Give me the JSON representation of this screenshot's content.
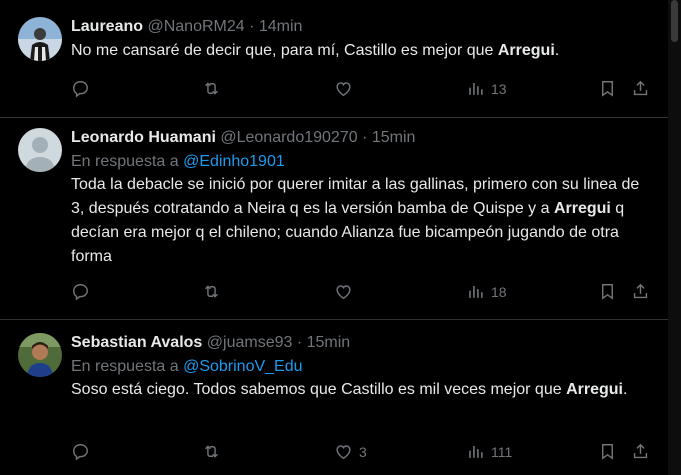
{
  "tweets": [
    {
      "name": "Laureano",
      "handle": "@NanoRM24",
      "sep": "·",
      "time": "14min",
      "reply_prefix": "",
      "reply_to": "",
      "text_before": "No me cansaré de decir que, para mí, Castillo es mejor que ",
      "text_bold": "Arregui",
      "text_after": ".",
      "replies": "",
      "retweets": "",
      "likes": "",
      "views": "13"
    },
    {
      "name": "Leonardo Huamani",
      "handle": "@Leonardo190270",
      "sep": "·",
      "time": "15min",
      "reply_prefix": "En respuesta a ",
      "reply_to": "@Edinho1901",
      "text_before": "Toda la debacle se inició por querer imitar a las gallinas, primero con su linea de 3, después cotratando a Neira q es la versión bamba de Quispe y a ",
      "text_bold": "Arregui",
      "text_after": " q decían era mejor q el chileno; cuando Alianza fue bicampeón jugando de otra forma",
      "replies": "",
      "retweets": "",
      "likes": "",
      "views": "18"
    },
    {
      "name": "Sebastian Avalos",
      "handle": "@juamse93",
      "sep": "·",
      "time": "15min",
      "reply_prefix": "En respuesta a ",
      "reply_to": "@SobrinoV_Edu",
      "text_before": "Soso está ciego. Todos sabemos que Castillo es mil veces mejor que ",
      "text_bold": "Arregui",
      "text_after": ".",
      "replies": "",
      "retweets": "",
      "likes": "3",
      "views": "111"
    }
  ],
  "icons": {
    "reply": "reply-icon",
    "retweet": "retweet-icon",
    "like": "heart-icon",
    "views": "views-icon",
    "bookmark": "bookmark-icon",
    "share": "share-icon"
  },
  "colors": {
    "background": "#000000",
    "text": "#e7e9ea",
    "muted": "#71767b",
    "link": "#1d9bf0",
    "divider": "#2f3336"
  }
}
